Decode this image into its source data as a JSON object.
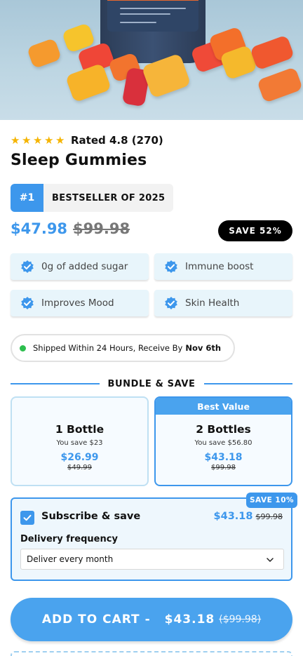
{
  "product": {
    "rating_text": "Rated 4.8 (270)",
    "stars": 5,
    "title": "Sleep Gummies",
    "badge_rank": "#1",
    "badge_text": "BESTSELLER OF 2025",
    "price": "$47.98",
    "old_price": "$99.98",
    "save_label": "SAVE 52%"
  },
  "features": [
    {
      "label": "0g of added sugar",
      "icon": "check-badge-icon"
    },
    {
      "label": "Immune boost",
      "icon": "check-badge-icon"
    },
    {
      "label": "Improves Mood",
      "icon": "check-badge-icon"
    },
    {
      "label": "Skin Health",
      "icon": "check-badge-icon"
    }
  ],
  "shipping": {
    "text": "Shipped Within 24 Hours, Receive By",
    "date": "Nov 6th"
  },
  "bundle": {
    "title": "BUNDLE & SAVE",
    "options": [
      {
        "name": "1 Bottle",
        "save": "You save $23",
        "price": "$26.99",
        "old_price": "$49.99",
        "tag": ""
      },
      {
        "name": "2 Bottles",
        "save": "You save $56.80",
        "price": "$43.18",
        "old_price": "$99.98",
        "tag": "Best Value"
      }
    ]
  },
  "subscribe": {
    "save_tag": "SAVE 10%",
    "title": "Subscribe & save",
    "price": "$43.18",
    "old_price": "$99.98",
    "frequency_label": "Delivery frequency",
    "frequency_value": "Deliver every month",
    "checked": true
  },
  "cart": {
    "label": "ADD TO CART -",
    "price": "$43.18",
    "old_price": "($99.98)"
  },
  "colors": {
    "accent": "#3d97ec",
    "star": "#f5b400",
    "feature_bg": "#e8f5fb",
    "dot": "#2dbe4e"
  }
}
